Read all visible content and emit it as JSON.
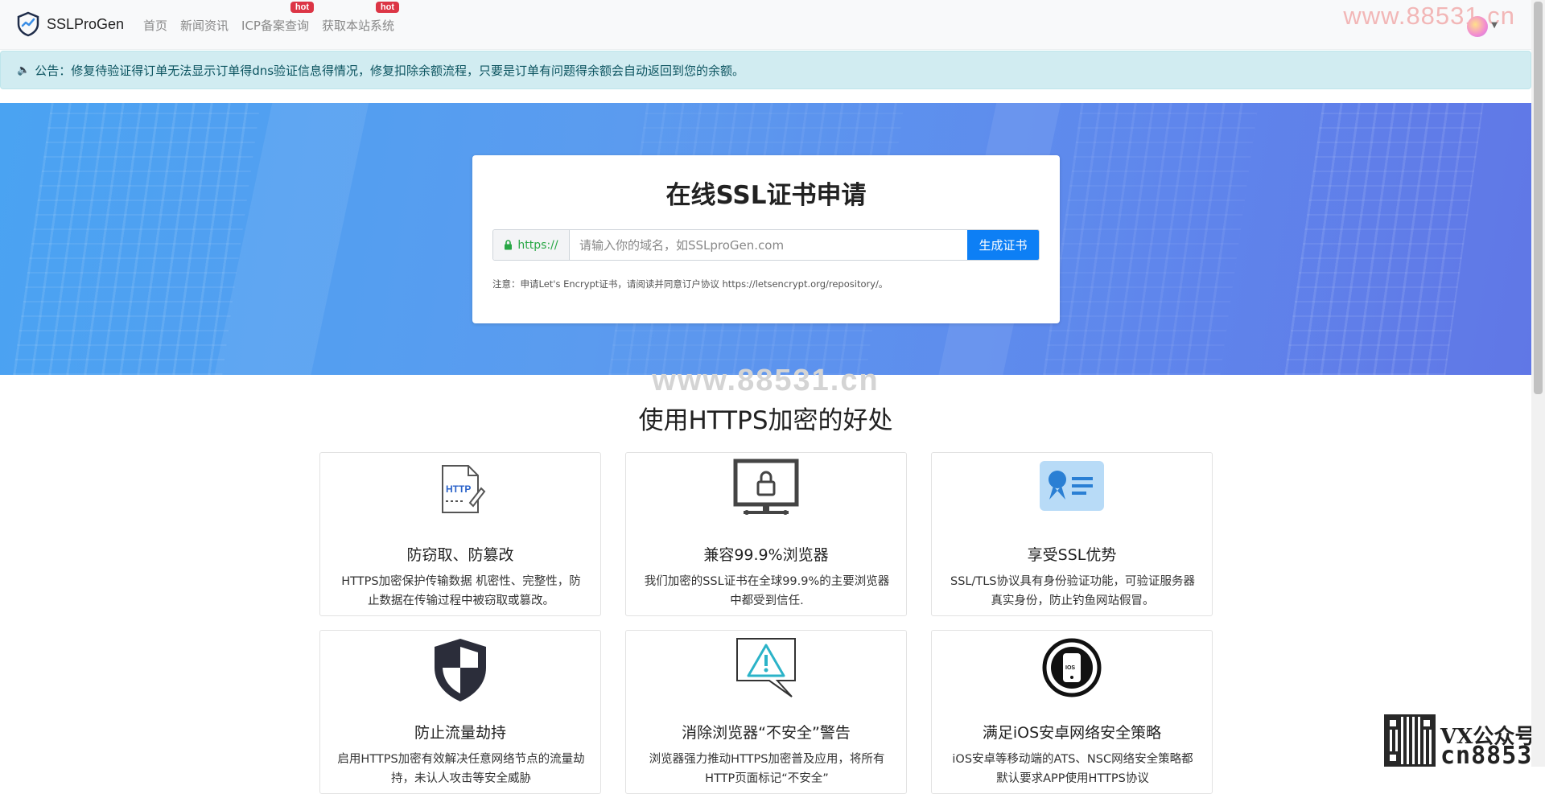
{
  "navbar": {
    "brand": "SSLProGen",
    "links": [
      {
        "label": "首页",
        "hot": ""
      },
      {
        "label": "新闻资讯",
        "hot": ""
      },
      {
        "label": "ICP备案查询",
        "hot": "hot"
      },
      {
        "label": "获取本站系统",
        "hot": "hot"
      }
    ],
    "watermark": "www.88531.cn"
  },
  "notice": {
    "text": "公告：修复待验证得订单无法显示订单得dns验证信息得情况，修复扣除余额流程，只要是订单有问题得余额会自动返回到您的余额。"
  },
  "cert_form": {
    "title": "在线SSL证书申请",
    "prefix": "https://",
    "placeholder": "请输入你的域名，如SSLproGen.com",
    "submit_label": "生成证书",
    "note": "注意：申请Let's Encrypt证书，请阅读并同意订户协议 https://letsencrypt.org/repository/。"
  },
  "watermark_mid": "www.88531.cn",
  "benefits": {
    "title": "使用HTTPS加密的好处",
    "cards": [
      {
        "icon": "http-document-icon",
        "icon_text": "HTTP",
        "title": "防窃取、防篡改",
        "desc": "HTTPS加密保护传输数据 机密性、完整性，防止数据在传输过程中被窃取或篡改。"
      },
      {
        "icon": "monitor-lock-icon",
        "title": "兼容99.9%浏览器",
        "desc": "我们加密的SSL证书在全球99.9%的主要浏览器中都受到信任."
      },
      {
        "icon": "id-badge-icon",
        "title": "享受SSL优势",
        "desc": "SSL/TLS协议具有身份验证功能，可验证服务器真实身份，防止钓鱼网站假冒。"
      },
      {
        "icon": "shield-icon",
        "title": "防止流量劫持",
        "desc": "启用HTTPS加密有效解决任意网络节点的流量劫持，未认人攻击等安全威胁"
      },
      {
        "icon": "warning-chat-icon",
        "title": "消除浏览器“不安全”警告",
        "desc": "浏览器强力推动HTTPS加密普及应用，将所有HTTP页面标记“不安全”"
      },
      {
        "icon": "ios-phone-icon",
        "icon_text": "IOS",
        "title": "满足iOS安卓网络安全策略",
        "desc": "iOS安卓等移动端的ATS、NSC网络安全策略都默认要求APP使用HTTPS协议"
      }
    ]
  },
  "footer_watermark": {
    "line1": "VX公众号",
    "line2": "cn88531"
  },
  "colors": {
    "primary": "#0d7ff5",
    "notice_bg": "#d1ecf1",
    "hot": "#dc3545",
    "hero_start": "#4aa3f2",
    "hero_end": "#6077e6"
  }
}
